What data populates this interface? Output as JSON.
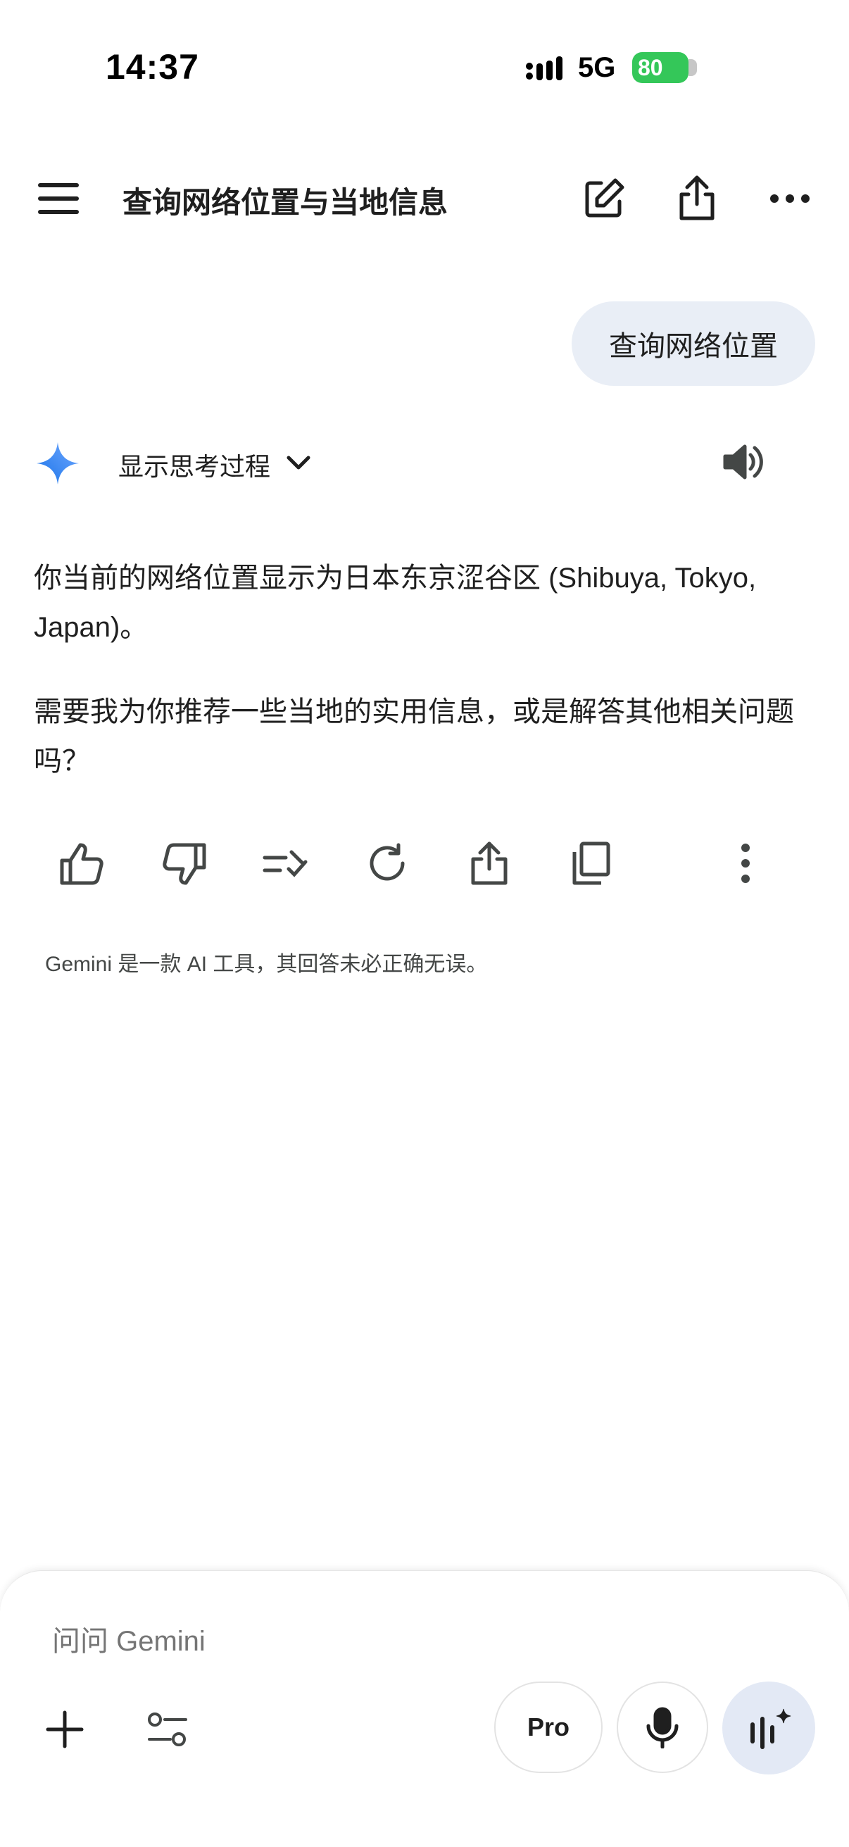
{
  "status_bar": {
    "time": "14:37",
    "network": "5G",
    "battery": "80"
  },
  "header": {
    "title": "查询网络位置与当地信息"
  },
  "conversation": {
    "user_message": "查询网络位置",
    "assistant": {
      "show_thinking_label": "显示思考过程",
      "paragraphs": [
        "你当前的网络位置显示为日本东京涩谷区 (Shibuya, Tokyo, Japan)。",
        "需要我为你推荐一些当地的实用信息，或是解答其他相关问题吗？"
      ]
    }
  },
  "disclaimer": "Gemini 是一款 AI 工具，其回答未必正确无误。",
  "composer": {
    "placeholder": "问问 Gemini",
    "pro_label": "Pro"
  },
  "colors": {
    "accent": "#4285f4",
    "bubble": "#e9eef6",
    "battery": "#34c759",
    "live_button": "#e3e9f5"
  }
}
